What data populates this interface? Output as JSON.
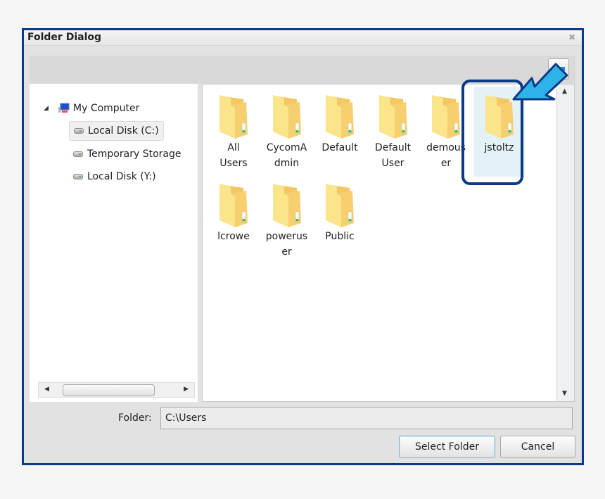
{
  "dialog": {
    "title": "Folder Dialog",
    "close_icon": "close-icon"
  },
  "toolbar": {
    "back_icon": "arrow-left-icon"
  },
  "tree": {
    "root": {
      "label": "My Computer",
      "icon": "computer-icon",
      "expanded": true
    },
    "items": [
      {
        "label": "Local Disk (C:)",
        "icon": "disk-icon",
        "selected": true
      },
      {
        "label": "Temporary Storage",
        "icon": "disk-icon",
        "selected": false
      },
      {
        "label": "Local Disk (Y:)",
        "icon": "disk-icon",
        "selected": false
      }
    ]
  },
  "files": {
    "items": [
      {
        "label": "All Users"
      },
      {
        "label": "CycomAdmin"
      },
      {
        "label": "Default"
      },
      {
        "label": "Default User"
      },
      {
        "label": "demouser"
      },
      {
        "label": "jstoltz",
        "selected": true
      },
      {
        "label": "lcrowe"
      },
      {
        "label": "poweruser"
      },
      {
        "label": "Public"
      }
    ],
    "display_labels": [
      "All\nUsers",
      "CycomA\ndmin",
      "Default",
      "Default\nUser",
      "demous\ner",
      "jstoltz",
      "lcrowe",
      "powerus\ner",
      "Public"
    ]
  },
  "footer": {
    "folder_label": "Folder:",
    "folder_value": "C:\\Users",
    "select_button": "Select Folder",
    "cancel_button": "Cancel"
  },
  "annotation": {
    "highlight_color": "#0b3a86",
    "arrow_color": "#2cb3e8"
  }
}
